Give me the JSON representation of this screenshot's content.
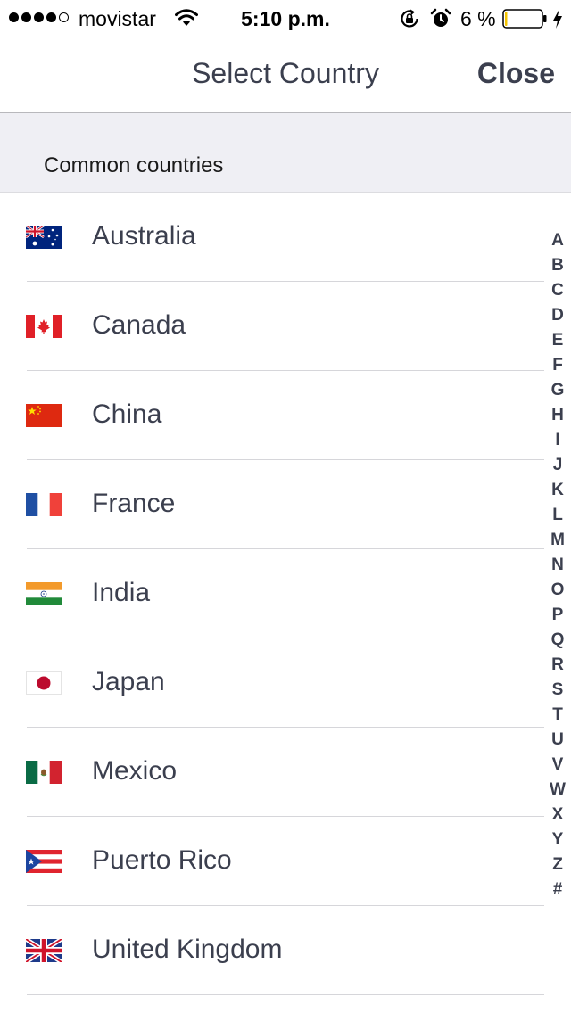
{
  "status_bar": {
    "carrier": "movistar",
    "time": "5:10 p.m.",
    "battery_percent": "6 %",
    "signal_bars_filled": 4,
    "signal_bars_total": 5,
    "battery_level": 0.06,
    "battery_color": "#f5c400",
    "icons": [
      "wifi-icon",
      "lock-rotation-icon",
      "alarm-icon",
      "battery-icon",
      "charging-icon"
    ]
  },
  "nav": {
    "title": "Select Country",
    "close_label": "Close"
  },
  "section": {
    "header": "Common countries"
  },
  "countries": [
    {
      "name": "Australia",
      "flag": "australia-flag-icon"
    },
    {
      "name": "Canada",
      "flag": "canada-flag-icon"
    },
    {
      "name": "China",
      "flag": "china-flag-icon"
    },
    {
      "name": "France",
      "flag": "france-flag-icon"
    },
    {
      "name": "India",
      "flag": "india-flag-icon"
    },
    {
      "name": "Japan",
      "flag": "japan-flag-icon"
    },
    {
      "name": "Mexico",
      "flag": "mexico-flag-icon"
    },
    {
      "name": "Puerto Rico",
      "flag": "puerto-rico-flag-icon"
    },
    {
      "name": "United Kingdom",
      "flag": "united-kingdom-flag-icon"
    }
  ],
  "index_letters": [
    "A",
    "B",
    "C",
    "D",
    "E",
    "F",
    "G",
    "H",
    "I",
    "J",
    "K",
    "L",
    "M",
    "N",
    "O",
    "P",
    "Q",
    "R",
    "S",
    "T",
    "U",
    "V",
    "W",
    "X",
    "Y",
    "Z",
    "#"
  ],
  "colors": {
    "text": "#3b3f4e",
    "section_background": "#efeff4",
    "separator": "#d6d6da"
  }
}
